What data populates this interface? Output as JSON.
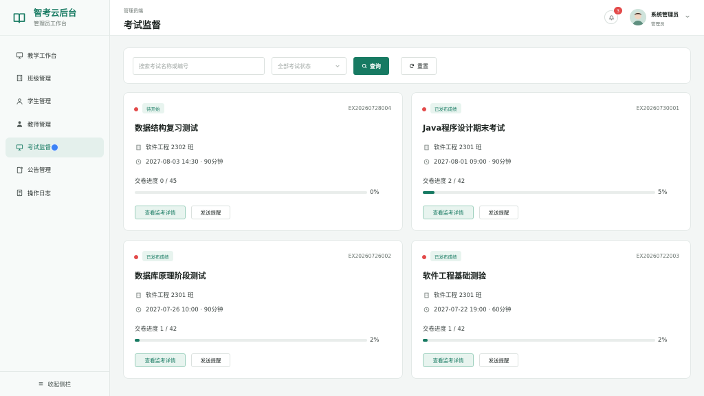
{
  "brand": {
    "title": "智考云后台",
    "subtitle": "管理员工作台"
  },
  "sidebar": {
    "items": [
      {
        "label": "教学工作台",
        "icon": "dashboard-icon"
      },
      {
        "label": "班级管理",
        "icon": "building-icon"
      },
      {
        "label": "学生管理",
        "icon": "user-icon"
      },
      {
        "label": "教师管理",
        "icon": "teacher-icon"
      },
      {
        "label": "考试监督",
        "icon": "monitor-icon",
        "active": true
      },
      {
        "label": "公告管理",
        "icon": "notice-icon"
      },
      {
        "label": "操作日志",
        "icon": "log-icon"
      }
    ],
    "collapse_label": "收起侧栏"
  },
  "header": {
    "breadcrumb": "管理员端",
    "title": "考试监督",
    "notification_count": "3",
    "user_name": "系统管理员",
    "user_role": "管理员"
  },
  "filter": {
    "search_placeholder": "搜索考试名称或编号",
    "status_select": "全部考试状态",
    "query_label": "查询",
    "reset_label": "重置"
  },
  "exams": [
    {
      "status": "待开始",
      "code": "EX20260728004",
      "title": "数据结构复习测试",
      "class": "软件工程 2302 班",
      "time": "2027-08-03 14:30 · 90分钟",
      "progress_label": "交卷进度 0 / 45",
      "percent": "0%",
      "progress": 0.0
    },
    {
      "status": "已发布成绩",
      "code": "EX20260730001",
      "title": "Java程序设计期末考试",
      "class": "软件工程 2301 班",
      "time": "2027-08-01 09:00 · 90分钟",
      "progress_label": "交卷进度 2 / 42",
      "percent": "5%",
      "progress": 0.05
    },
    {
      "status": "已发布成绩",
      "code": "EX20260726002",
      "title": "数据库原理阶段测试",
      "class": "软件工程 2301 班",
      "time": "2027-07-26 10:00 · 90分钟",
      "progress_label": "交卷进度 1 / 42",
      "percent": "2%",
      "progress": 0.02
    },
    {
      "status": "已发布成绩",
      "code": "EX20260722003",
      "title": "软件工程基础测验",
      "class": "软件工程 2301 班",
      "time": "2027-07-22 19:00 · 60分钟",
      "progress_label": "交卷进度 1 / 42",
      "percent": "2%",
      "progress": 0.02
    }
  ],
  "card_actions": {
    "detail_label": "查看监考详情",
    "remind_label": "发送提醒"
  },
  "colors": {
    "accent": "#177a62",
    "status_dot": "#e34a4a",
    "badge_bg": "#e8f4ef"
  }
}
